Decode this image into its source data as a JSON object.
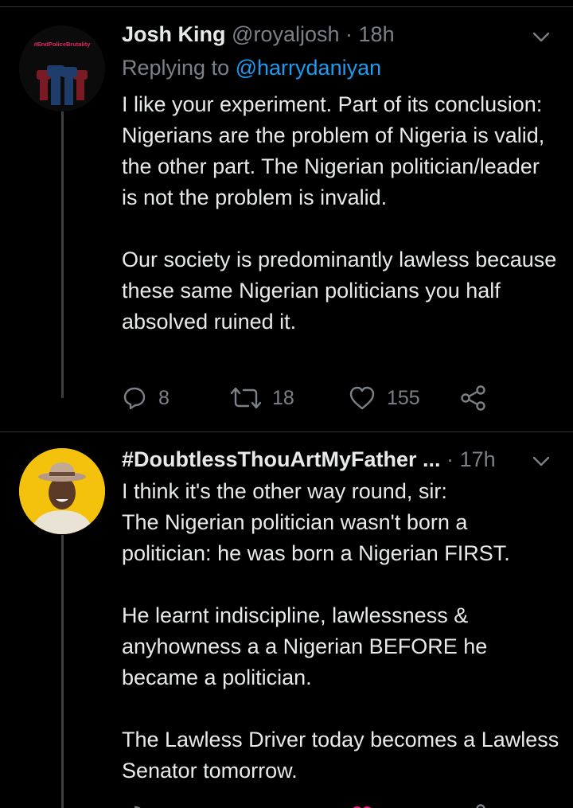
{
  "tweets": [
    {
      "author_name": "Josh King",
      "handle": "@royaljosh",
      "time_sep": "·",
      "time": "18h",
      "replying_prefix": "Replying to",
      "replying_to": "@harrydaniyan",
      "avatar_badge_text": "#EndPoliceBrutality",
      "text": "I like your experiment. Part of its conclusion: Nigerians are the problem of Nigeria is valid, the other part. The Nigerian politician/leader is not the problem is invalid.\n\nOur society is predominantly lawless because these same Nigerian politicians you half absolved ruined it.",
      "replies": "8",
      "retweets": "18",
      "likes": "155"
    },
    {
      "author_name": "#DoubtlessThouArtMyFather ...",
      "time_sep": "·",
      "time": "17h",
      "text": "I think it's the other way round, sir:\nThe Nigerian politician wasn't born a politician: he was born a Nigerian FIRST.\n\nHe learnt indiscipline, lawlessness & anyhowness a a Nigerian BEFORE he became a politician.\n\nThe Lawless Driver today becomes a Lawless Senator tomorrow."
    }
  ],
  "icons": {
    "reply": "reply-icon",
    "retweet": "retweet-icon",
    "like": "heart-icon",
    "share": "share-icon",
    "menu": "chevron-down-icon"
  },
  "colors": {
    "background": "#000000",
    "text": "#e7e9ea",
    "muted": "#7b8187",
    "link": "#1d9bf0",
    "like_red": "#f91880"
  }
}
